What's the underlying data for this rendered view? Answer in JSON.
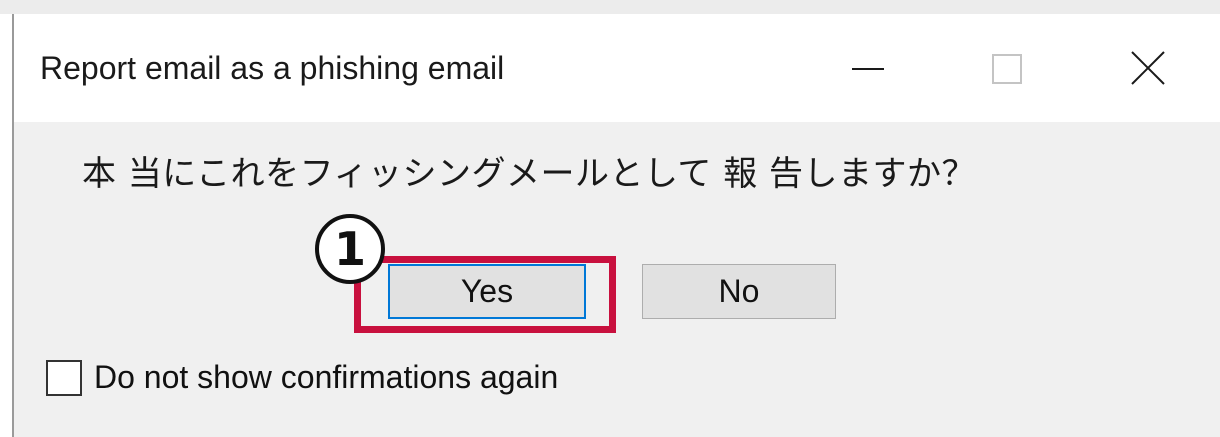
{
  "dialog": {
    "title": "Report email as a phishing email",
    "question": "本 当にこれをフィッシングメールとして 報 告しますか？",
    "yes_label": "Yes",
    "no_label": "No",
    "checkbox_label": "Do not show confirmations again",
    "checkbox_checked": false
  },
  "annotation": {
    "step_number": "1",
    "highlight_color": "#c8103e"
  },
  "window_controls": {
    "minimize_icon": "minimize-icon",
    "maximize_icon": "maximize-icon",
    "close_icon": "close-icon"
  },
  "colors": {
    "dialog_background": "#f0f0f0",
    "titlebar_background": "#ffffff",
    "default_button_border": "#0078d7",
    "button_background": "#e1e1e1"
  }
}
